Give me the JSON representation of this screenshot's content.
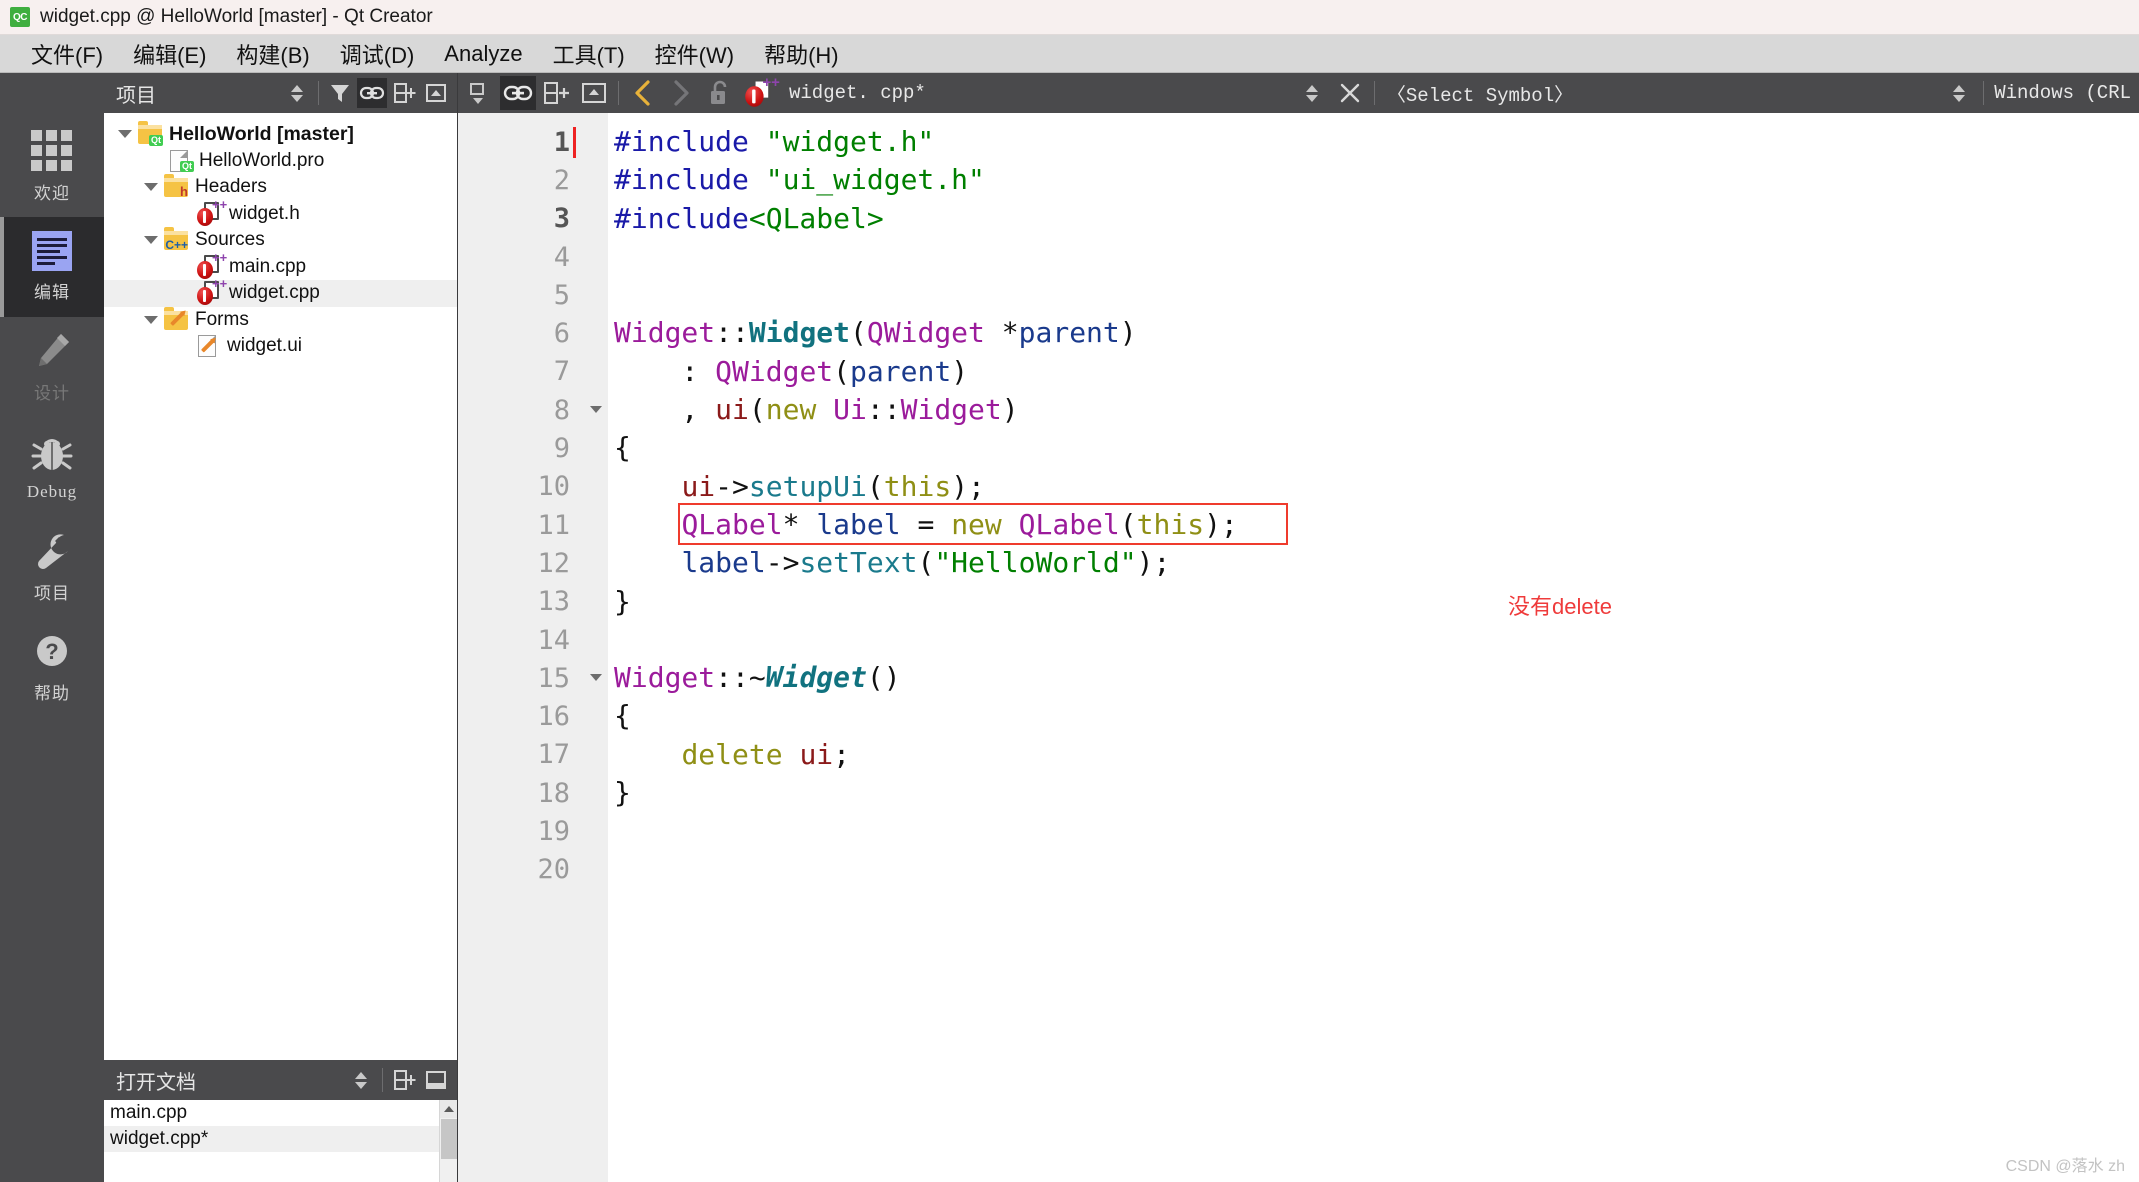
{
  "window": {
    "logo_text": "QC",
    "title": "widget.cpp @ HelloWorld [master] - Qt Creator"
  },
  "menubar": {
    "items": [
      {
        "label": "文件(F)",
        "accel": "F"
      },
      {
        "label": "编辑(E)",
        "accel": "E"
      },
      {
        "label": "构建(B)",
        "accel": "B"
      },
      {
        "label": "调试(D)",
        "accel": "D"
      },
      {
        "label": "Analyze",
        "accel": "A"
      },
      {
        "label": "工具(T)",
        "accel": "T"
      },
      {
        "label": "控件(W)",
        "accel": "W"
      },
      {
        "label": "帮助(H)",
        "accel": "H"
      }
    ]
  },
  "modebar": {
    "items": [
      {
        "label": "欢迎",
        "icon": "grid-icon",
        "state": "normal"
      },
      {
        "label": "编辑",
        "icon": "edit-lines-icon",
        "state": "active"
      },
      {
        "label": "设计",
        "icon": "pencil-icon",
        "state": "disabled"
      },
      {
        "label": "Debug",
        "icon": "bug-icon",
        "state": "normal"
      },
      {
        "label": "项目",
        "icon": "wrench-icon",
        "state": "normal"
      },
      {
        "label": "帮助",
        "icon": "question-mark-icon",
        "state": "normal"
      }
    ]
  },
  "project_dock": {
    "title": "项目",
    "toolbar": {
      "sync_icon": "up-down-arrows-icon",
      "filter_icon": "funnel-icon",
      "link_icon": "link-icon",
      "split_icon": "split-pane-icon",
      "collapse_icon": "collapse-icon"
    },
    "tree": [
      {
        "label": "HelloWorld [master]",
        "icon": "qt-project-folder-icon",
        "indent": 0,
        "twisty": true,
        "bold": true,
        "selected": false
      },
      {
        "label": "HelloWorld.pro",
        "icon": "qt-pro-file-icon",
        "indent": 1,
        "twisty": false,
        "bold": false,
        "selected": false
      },
      {
        "label": "Headers",
        "icon": "headers-folder-icon",
        "indent": 1,
        "twisty": true,
        "bold": false,
        "selected": false
      },
      {
        "label": "widget.h",
        "icon": "cpp-source-icon",
        "indent": 2,
        "twisty": false,
        "bold": false,
        "selected": false
      },
      {
        "label": "Sources",
        "icon": "sources-folder-icon",
        "indent": 1,
        "twisty": true,
        "bold": false,
        "selected": false
      },
      {
        "label": "main.cpp",
        "icon": "cpp-source-icon",
        "indent": 2,
        "twisty": false,
        "bold": false,
        "selected": false
      },
      {
        "label": "widget.cpp",
        "icon": "cpp-source-icon",
        "indent": 2,
        "twisty": false,
        "bold": false,
        "selected": true
      },
      {
        "label": "Forms",
        "icon": "forms-folder-icon",
        "indent": 1,
        "twisty": true,
        "bold": false,
        "selected": false
      },
      {
        "label": "widget.ui",
        "icon": "ui-file-icon",
        "indent": 2,
        "twisty": false,
        "bold": false,
        "selected": false
      }
    ]
  },
  "open_documents": {
    "title": "打开文档",
    "toolbar": {
      "sync_icon": "up-down-arrows-icon",
      "split_icon": "split-pane-icon",
      "close_icon": "close-pane-icon"
    },
    "items": [
      {
        "label": "main.cpp",
        "selected": false
      },
      {
        "label": "widget.cpp*",
        "selected": true
      }
    ]
  },
  "editor_toolbar": {
    "mode_icon": "editor-mode-icon",
    "link_icon": "link-icon",
    "split_icon": "split-pane-icon",
    "unsplit_icon": "unsplit-icon",
    "back_icon": "chevron-left-icon",
    "forward_icon": "chevron-right-icon",
    "lock_icon": "unlock-icon",
    "file_icon": "cpp-source-icon",
    "file_label": "widget. cpp*",
    "updown_icon": "up-down-arrows-icon",
    "close_icon": "close-icon",
    "symbol_label": "〈Select Symbol〉",
    "updown_icon2": "up-down-arrows-icon",
    "line_ending_label": "Windows (CRL"
  },
  "editor": {
    "lines": [
      {
        "n": "1",
        "current": true,
        "caret": true,
        "fold": false,
        "tokens": [
          {
            "t": "#include ",
            "c": "pre"
          },
          {
            "t": "\"widget.h\"",
            "c": "str"
          }
        ]
      },
      {
        "n": "2",
        "current": false,
        "caret": false,
        "fold": false,
        "tokens": [
          {
            "t": "#include ",
            "c": "pre"
          },
          {
            "t": "\"ui_widget.h\"",
            "c": "str"
          }
        ]
      },
      {
        "n": "3",
        "current": true,
        "caret": false,
        "fold": false,
        "tokens": [
          {
            "t": "#include",
            "c": "pre"
          },
          {
            "t": "<QLabel>",
            "c": "str"
          }
        ]
      },
      {
        "n": "4",
        "current": false,
        "caret": false,
        "fold": false,
        "tokens": []
      },
      {
        "n": "5",
        "current": false,
        "caret": false,
        "fold": false,
        "tokens": []
      },
      {
        "n": "6",
        "current": false,
        "caret": false,
        "fold": false,
        "tokens": [
          {
            "t": "Widget",
            "c": "cls"
          },
          {
            "t": "::",
            "c": "pun"
          },
          {
            "t": "Widget",
            "c": "fnb"
          },
          {
            "t": "(",
            "c": "pun"
          },
          {
            "t": "QWidget",
            "c": "cls"
          },
          {
            "t": " *",
            "c": "pun"
          },
          {
            "t": "parent",
            "c": "var"
          },
          {
            "t": ")",
            "c": "pun"
          }
        ]
      },
      {
        "n": "7",
        "current": false,
        "caret": false,
        "fold": false,
        "tokens": [
          {
            "t": "    : ",
            "c": "pun"
          },
          {
            "t": "QWidget",
            "c": "cls"
          },
          {
            "t": "(",
            "c": "pun"
          },
          {
            "t": "parent",
            "c": "var"
          },
          {
            "t": ")",
            "c": "pun"
          }
        ]
      },
      {
        "n": "8",
        "current": false,
        "caret": false,
        "fold": true,
        "tokens": [
          {
            "t": "    , ",
            "c": "pun"
          },
          {
            "t": "ui",
            "c": "mem"
          },
          {
            "t": "(",
            "c": "pun"
          },
          {
            "t": "new",
            "c": "kw"
          },
          {
            "t": " ",
            "c": "pun"
          },
          {
            "t": "Ui",
            "c": "cls"
          },
          {
            "t": "::",
            "c": "pun"
          },
          {
            "t": "Widget",
            "c": "cls"
          },
          {
            "t": ")",
            "c": "pun"
          }
        ]
      },
      {
        "n": "9",
        "current": false,
        "caret": false,
        "fold": false,
        "tokens": [
          {
            "t": "{",
            "c": "pun"
          }
        ]
      },
      {
        "n": "10",
        "current": false,
        "caret": false,
        "fold": false,
        "tokens": [
          {
            "t": "    ",
            "c": "pun"
          },
          {
            "t": "ui",
            "c": "mem"
          },
          {
            "t": "->",
            "c": "pun"
          },
          {
            "t": "setupUi",
            "c": "fn"
          },
          {
            "t": "(",
            "c": "pun"
          },
          {
            "t": "this",
            "c": "kw"
          },
          {
            "t": ");",
            "c": "pun"
          }
        ]
      },
      {
        "n": "11",
        "current": false,
        "caret": false,
        "fold": false,
        "tokens": [
          {
            "t": "    ",
            "c": "pun"
          },
          {
            "t": "QLabel",
            "c": "cls"
          },
          {
            "t": "* ",
            "c": "pun"
          },
          {
            "t": "label",
            "c": "var"
          },
          {
            "t": " = ",
            "c": "pun"
          },
          {
            "t": "new",
            "c": "kw"
          },
          {
            "t": " ",
            "c": "pun"
          },
          {
            "t": "QLabel",
            "c": "cls"
          },
          {
            "t": "(",
            "c": "pun"
          },
          {
            "t": "this",
            "c": "kw"
          },
          {
            "t": ");",
            "c": "pun"
          }
        ]
      },
      {
        "n": "12",
        "current": false,
        "caret": false,
        "fold": false,
        "tokens": [
          {
            "t": "    ",
            "c": "pun"
          },
          {
            "t": "label",
            "c": "var"
          },
          {
            "t": "->",
            "c": "pun"
          },
          {
            "t": "setText",
            "c": "fn"
          },
          {
            "t": "(",
            "c": "pun"
          },
          {
            "t": "\"HelloWorld\"",
            "c": "str"
          },
          {
            "t": ");",
            "c": "pun"
          }
        ]
      },
      {
        "n": "13",
        "current": false,
        "caret": false,
        "fold": false,
        "tokens": [
          {
            "t": "}",
            "c": "pun"
          }
        ]
      },
      {
        "n": "14",
        "current": false,
        "caret": false,
        "fold": false,
        "tokens": []
      },
      {
        "n": "15",
        "current": false,
        "caret": false,
        "fold": true,
        "tokens": [
          {
            "t": "Widget",
            "c": "cls"
          },
          {
            "t": "::~",
            "c": "pun"
          },
          {
            "t": "Widget",
            "c": "fnbi"
          },
          {
            "t": "()",
            "c": "pun"
          }
        ]
      },
      {
        "n": "16",
        "current": false,
        "caret": false,
        "fold": false,
        "tokens": [
          {
            "t": "{",
            "c": "pun"
          }
        ]
      },
      {
        "n": "17",
        "current": false,
        "caret": false,
        "fold": false,
        "tokens": [
          {
            "t": "    ",
            "c": "pun"
          },
          {
            "t": "delete",
            "c": "kw"
          },
          {
            "t": " ",
            "c": "pun"
          },
          {
            "t": "ui",
            "c": "mem"
          },
          {
            "t": ";",
            "c": "pun"
          }
        ]
      },
      {
        "n": "18",
        "current": false,
        "caret": false,
        "fold": false,
        "tokens": [
          {
            "t": "}",
            "c": "pun"
          }
        ]
      },
      {
        "n": "19",
        "current": false,
        "caret": false,
        "fold": false,
        "tokens": []
      },
      {
        "n": "20",
        "current": false,
        "caret": false,
        "fold": false,
        "tokens": []
      }
    ],
    "annotation": {
      "text": "没有delete",
      "color": "#ef3b3b"
    },
    "highlight_box": {
      "color": "#ef3b2d",
      "line": "11"
    }
  },
  "watermark": {
    "text": "CSDN @落水 zh"
  }
}
